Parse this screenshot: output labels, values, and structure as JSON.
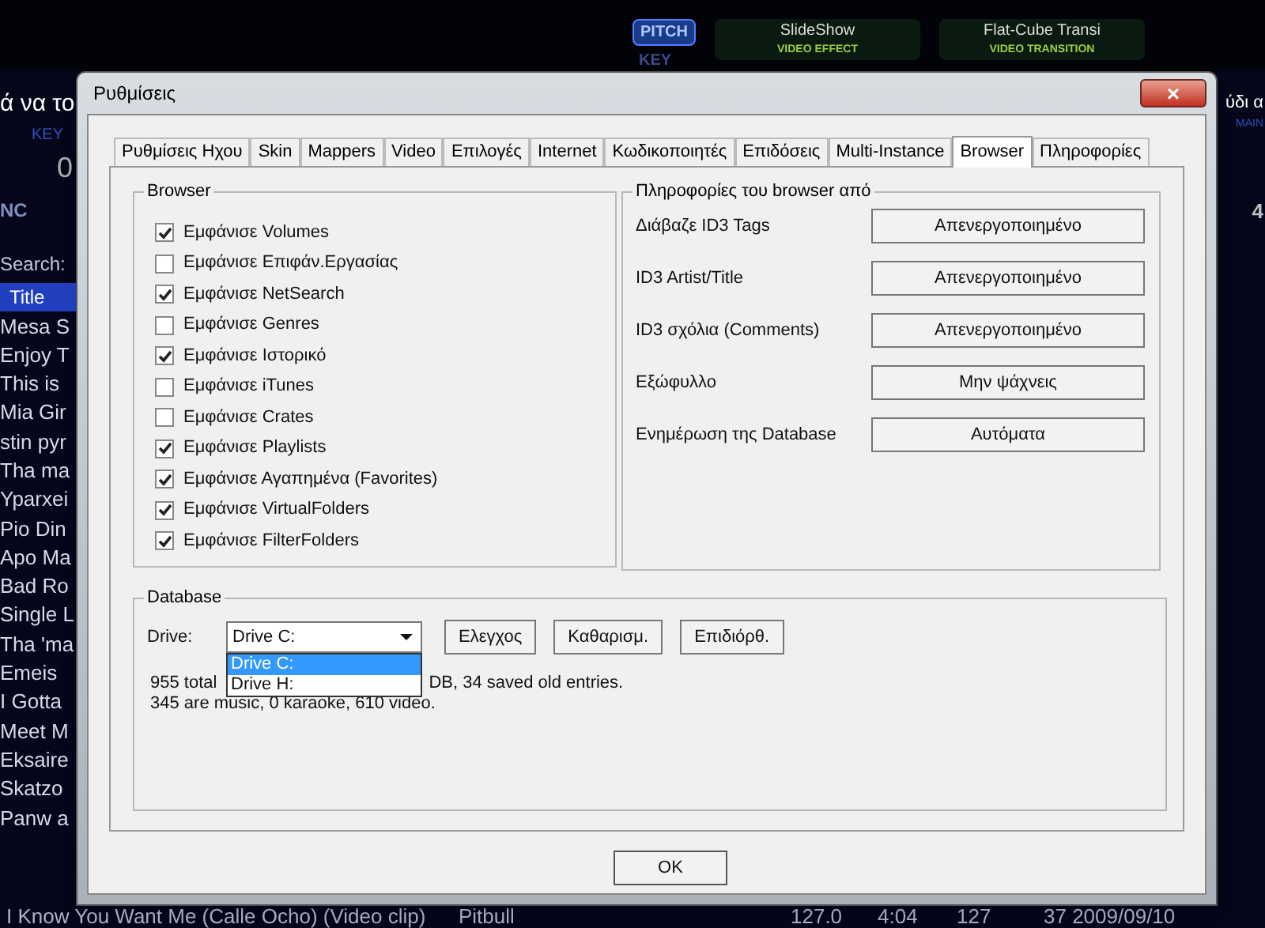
{
  "background_app": {
    "top_controls": [
      {
        "label": "PITCH",
        "selected": true
      },
      {
        "label": "KEY",
        "selected": false
      }
    ],
    "video_effect": {
      "name": "SlideShow",
      "caption": "VIDEO EFFECT"
    },
    "video_transition": {
      "name": "Flat-Cube Transi",
      "caption": "VIDEO TRANSITION"
    },
    "left_deck": {
      "title": "ά να το",
      "key_label": "KEY",
      "value": "0",
      "sync": "NC"
    },
    "right_deck": {
      "title": "ύδι α",
      "key_label": "MAIN",
      "value": "4"
    },
    "search_label": "Search:",
    "title_column": "Title",
    "tracks": [
      "Mesa S",
      "Enjoy T",
      "This is",
      "Mia Gir",
      "stin pyr",
      "Tha ma",
      "Yparxei",
      "Pio Din",
      "Apo Ma",
      "Bad Ro",
      "Single L",
      "Tha 'ma",
      "Emeis",
      "I Gotta",
      "Meet M",
      "Eksaire",
      "Skatzo",
      "Panw a"
    ],
    "bottom_track": {
      "title": "I Know You Want Me (Calle Ocho) (Video clip)",
      "artist": "Pitbull",
      "bpm": "127.0",
      "length": "4:04",
      "column_5": "127",
      "column_6": "37 2009/09/10"
    }
  },
  "window": {
    "title": "Ρυθμίσεις",
    "close": "×"
  },
  "tabs": [
    {
      "label": "Ρυθμίσεις Ηχου",
      "selected": false
    },
    {
      "label": "Skin",
      "selected": false
    },
    {
      "label": "Mappers",
      "selected": false
    },
    {
      "label": "Video",
      "selected": false
    },
    {
      "label": "Επιλογές",
      "selected": false
    },
    {
      "label": "Internet",
      "selected": false
    },
    {
      "label": "Κωδικοποιητές",
      "selected": false
    },
    {
      "label": "Επιδόσεις",
      "selected": false
    },
    {
      "label": "Multi-Instance",
      "selected": false
    },
    {
      "label": "Browser",
      "selected": true
    },
    {
      "label": "Πληροφορίες",
      "selected": false
    }
  ],
  "browser_group": {
    "title": "Browser",
    "items": [
      {
        "label": "Εμφάνισε Volumes",
        "checked": true
      },
      {
        "label": "Εμφάνισε Επιφάν.Εργασίας",
        "checked": false
      },
      {
        "label": "Εμφάνισε NetSearch",
        "checked": true
      },
      {
        "label": "Εμφάνισε Genres",
        "checked": false
      },
      {
        "label": "Εμφάνισε Ιστορικό",
        "checked": true
      },
      {
        "label": "Εμφάνισε iTunes",
        "checked": false
      },
      {
        "label": "Εμφάνισε Crates",
        "checked": false
      },
      {
        "label": "Εμφάνισε Playlists",
        "checked": true
      },
      {
        "label": "Εμφάνισε Αγαπημένα (Favorites)",
        "checked": true
      },
      {
        "label": "Εμφάνισε VirtualFolders",
        "checked": true
      },
      {
        "label": "Εμφάνισε FilterFolders",
        "checked": true
      }
    ]
  },
  "info_group": {
    "title": "Πληροφορίες του browser από",
    "rows": [
      {
        "label": "Διάβαζε ID3 Tags",
        "value": "Απενεργοποιημένο"
      },
      {
        "label": "ID3 Artist/Title",
        "value": "Απενεργοποιημένο"
      },
      {
        "label": "ID3 σχόλια (Comments)",
        "value": "Απενεργοποιημένο"
      },
      {
        "label": "Εξώφυλλο",
        "value": "Μην ψάχνεις"
      },
      {
        "label": "Ενημέρωση της Database",
        "value": "Αυτόματα"
      }
    ]
  },
  "database_group": {
    "title": "Database",
    "drive_label": "Drive:",
    "drive": {
      "value": "Drive C:",
      "expanded": true,
      "options": [
        {
          "label": "Drive C:",
          "selected": true
        },
        {
          "label": "Drive H:",
          "selected": false
        }
      ]
    },
    "buttons": [
      "Ελεγχος",
      "Καθαρισμ.",
      "Επιδιόρθ."
    ],
    "status_line_1_start": "955 total",
    "status_line_1_end": "DB, 34 saved old entries.",
    "status_line_2": "345 are music, 0 karaoke, 610 video."
  },
  "buttons": [
    "OK"
  ]
}
